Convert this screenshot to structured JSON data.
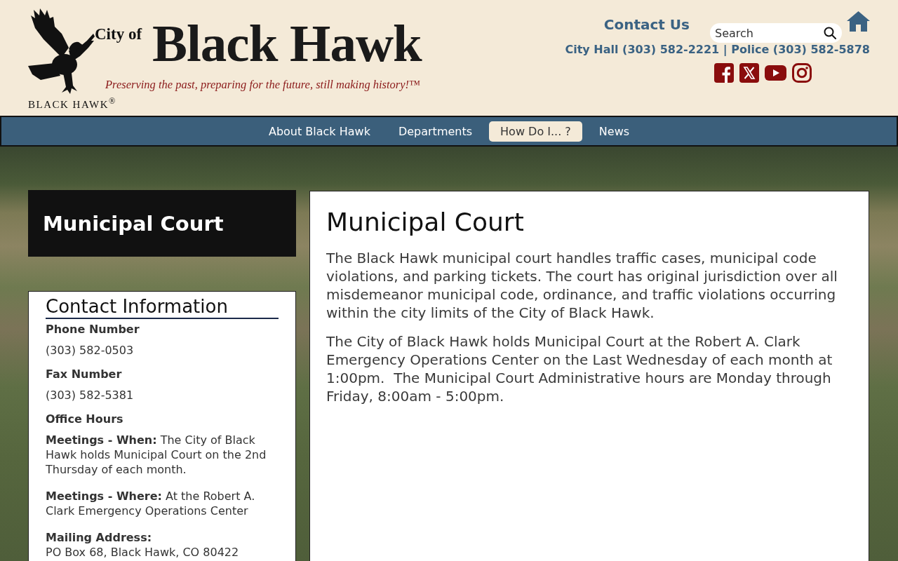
{
  "header": {
    "logo": {
      "prefix": "City of",
      "name": "Black Hawk",
      "tagline": "Preserving the past, preparing for the future, still making history!™",
      "wordmark": "BLACK HAWK$^{®}$"
    },
    "contact_link": "Contact Us",
    "search": {
      "placeholder": "Search"
    },
    "phone_line": "City Hall (303) 582-2221 | Police (303) 582-5878",
    "social": [
      {
        "kind": "facebook"
      },
      {
        "kind": "x"
      },
      {
        "kind": "youtube"
      },
      {
        "kind": "instagram"
      }
    ]
  },
  "nav": [
    {
      "label": "About Black Hawk",
      "selected": false
    },
    {
      "label": "Departments",
      "selected": false
    },
    {
      "label": "How Do I... ?",
      "selected": true
    },
    {
      "label": "News",
      "selected": false
    }
  ],
  "sidebar": {
    "title": "Municipal Court",
    "contact": {
      "heading": "Contact Information",
      "items": [
        {
          "kind": "label",
          "text": "Phone Number"
        },
        {
          "kind": "value",
          "text": "(303) 582-0503"
        },
        {
          "kind": "label",
          "text": "Fax Number"
        },
        {
          "kind": "value",
          "text": "(303) 582-5381"
        },
        {
          "kind": "label",
          "text": "Office Hours"
        },
        {
          "kind": "note",
          "label": "Meetings - When:",
          "text": "The City of Black Hawk holds Municipal Court on the 2nd Thursday of each month."
        },
        {
          "kind": "note",
          "label": "Meetings - Where:",
          "text": "At the Robert A. Clark Emergency Operations Center"
        },
        {
          "kind": "address",
          "label": "Mailing Address:",
          "text": "PO Box 68, Black Hawk, CO 80422"
        }
      ]
    }
  },
  "main": {
    "title": "Municipal Court",
    "paragraphs": [
      "The Black Hawk municipal court handles traffic cases, municipal code violations, and parking tickets. The court has original jurisdiction over all misdemeanor municipal code, ordinance, and traffic violations occurring within the city limits of the City of Black Hawk.",
      "The City of Black Hawk holds Municipal Court at the Robert A. Clark Emergency Operations Center on the Last Wednesday of each month at 1:00pm.  The Municipal Court Administrative hours are Monday through Friday, 8:00am - 5:00pm."
    ]
  }
}
